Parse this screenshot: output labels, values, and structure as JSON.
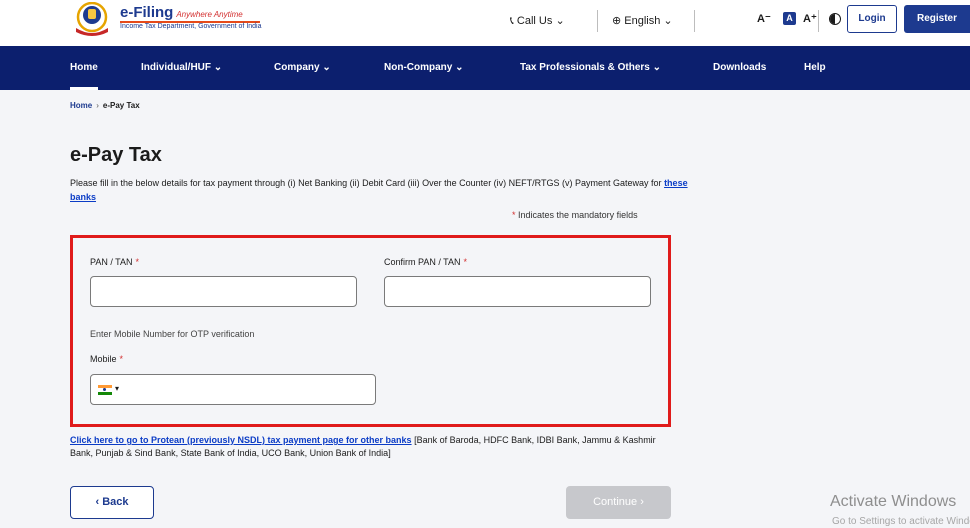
{
  "header": {
    "logo_title": "e-Filing",
    "logo_tagline": "Anywhere Anytime",
    "logo_department": "Income Tax Department, Government of India",
    "call_us": "Call Us",
    "language": "English",
    "font_decrease": "A⁻",
    "font_normal": "A",
    "font_increase": "A⁺",
    "login": "Login",
    "register": "Register"
  },
  "nav": {
    "items": [
      "Home",
      "Individual/HUF",
      "Company",
      "Non-Company",
      "Tax Professionals & Others",
      "Downloads",
      "Help"
    ]
  },
  "breadcrumb": {
    "home": "Home",
    "separator": "›",
    "current": "e-Pay Tax"
  },
  "page": {
    "title": "e-Pay Tax",
    "intro_text": "Please fill in the below details for tax payment through (i) Net Banking (ii) Debit Card (iii) Over the Counter (iv) NEFT/RTGS (v) Payment Gateway for ",
    "intro_link": "these banks",
    "mandatory_star": "*",
    "mandatory_note": "Indicates the mandatory fields"
  },
  "form": {
    "pan_label": "PAN / TAN",
    "confirm_pan_label": "Confirm PAN / TAN",
    "required_mark": "*",
    "otp_note": "Enter Mobile Number for OTP verification",
    "mobile_label": "Mobile",
    "pan_value": "",
    "confirm_pan_value": "",
    "mobile_value": ""
  },
  "protean": {
    "link": "Click here to go to Protean (previously NSDL) tax payment page for other banks",
    "banks": "[Bank of Baroda, HDFC Bank, IDBI Bank, Jammu & Kashmir Bank, Punjab & Sind Bank, State Bank of India, UCO Bank, Union Bank of India]"
  },
  "buttons": {
    "back": "Back",
    "continue": "Continue"
  },
  "watermark": {
    "title": "Activate Windows",
    "subtitle": "Go to Settings to activate Windows."
  },
  "colors": {
    "nav_bg": "#0c1f6e",
    "brand_blue": "#1d3a8f",
    "highlight_border": "#e01b1b",
    "required_star": "#d32f2f"
  }
}
